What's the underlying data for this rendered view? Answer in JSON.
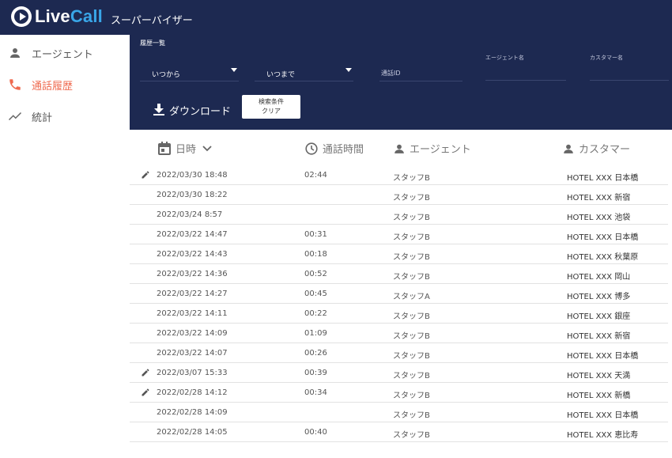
{
  "app": {
    "logo_live": "Live",
    "logo_call": "Call",
    "subtitle": "スーパーバイザー"
  },
  "sidebar": {
    "items": [
      {
        "label": "エージェント",
        "icon": "person-icon",
        "active": false
      },
      {
        "label": "通話履歴",
        "icon": "phone-icon",
        "active": true
      },
      {
        "label": "統計",
        "icon": "trending-icon",
        "active": false
      }
    ]
  },
  "filters": {
    "title": "履歴一覧",
    "from_value": "いつから",
    "to_value": "いつまで",
    "call_id_placeholder": "通話ID",
    "agent_label": "エージェント名",
    "customer_label": "カスタマー名",
    "download_label": "ダウンロード",
    "clear_line1": "検索条件",
    "clear_line2": "クリア"
  },
  "table": {
    "headers": {
      "datetime": "日時",
      "duration": "通話時間",
      "agent": "エージェント",
      "customer": "カスタマー"
    },
    "rows": [
      {
        "datetime": "2022/03/30 18:48",
        "duration": "02:44",
        "agent": "スタッフB",
        "customer": "HOTEL XXX 日本橋",
        "edit": true
      },
      {
        "datetime": "2022/03/30 18:22",
        "duration": "",
        "agent": "スタッフB",
        "customer": "HOTEL XXX 新宿",
        "edit": false
      },
      {
        "datetime": "2022/03/24 8:57",
        "duration": "",
        "agent": "スタッフB",
        "customer": "HOTEL XXX 池袋",
        "edit": false
      },
      {
        "datetime": "2022/03/22 14:47",
        "duration": "00:31",
        "agent": "スタッフB",
        "customer": "HOTEL XXX 日本橋",
        "edit": false
      },
      {
        "datetime": "2022/03/22 14:43",
        "duration": "00:18",
        "agent": "スタッフB",
        "customer": "HOTEL XXX 秋葉原",
        "edit": false
      },
      {
        "datetime": "2022/03/22 14:36",
        "duration": "00:52",
        "agent": "スタッフB",
        "customer": "HOTEL XXX 岡山",
        "edit": false
      },
      {
        "datetime": "2022/03/22 14:27",
        "duration": "00:45",
        "agent": "スタッフA",
        "customer": "HOTEL XXX 博多",
        "edit": false
      },
      {
        "datetime": "2022/03/22 14:11",
        "duration": "00:22",
        "agent": "スタッフB",
        "customer": "HOTEL XXX 銀座",
        "edit": false
      },
      {
        "datetime": "2022/03/22 14:09",
        "duration": "01:09",
        "agent": "スタッフB",
        "customer": "HOTEL XXX 新宿",
        "edit": false
      },
      {
        "datetime": "2022/03/22 14:07",
        "duration": "00:26",
        "agent": "スタッフB",
        "customer": "HOTEL XXX 日本橋",
        "edit": false
      },
      {
        "datetime": "2022/03/07 15:33",
        "duration": "00:39",
        "agent": "スタッフB",
        "customer": "HOTEL XXX 天満",
        "edit": true
      },
      {
        "datetime": "2022/02/28 14:12",
        "duration": "00:34",
        "agent": "スタッフB",
        "customer": "HOTEL XXX 新橋",
        "edit": true
      },
      {
        "datetime": "2022/02/28 14:09",
        "duration": "",
        "agent": "スタッフB",
        "customer": "HOTEL XXX 日本橋",
        "edit": false
      },
      {
        "datetime": "2022/02/28 14:05",
        "duration": "00:40",
        "agent": "スタッフB",
        "customer": "HOTEL XXX 恵比寿",
        "edit": false
      }
    ]
  },
  "colors": {
    "navy": "#1d2951",
    "accent": "#ef6a4f",
    "logo_call": "#39a6e8"
  }
}
